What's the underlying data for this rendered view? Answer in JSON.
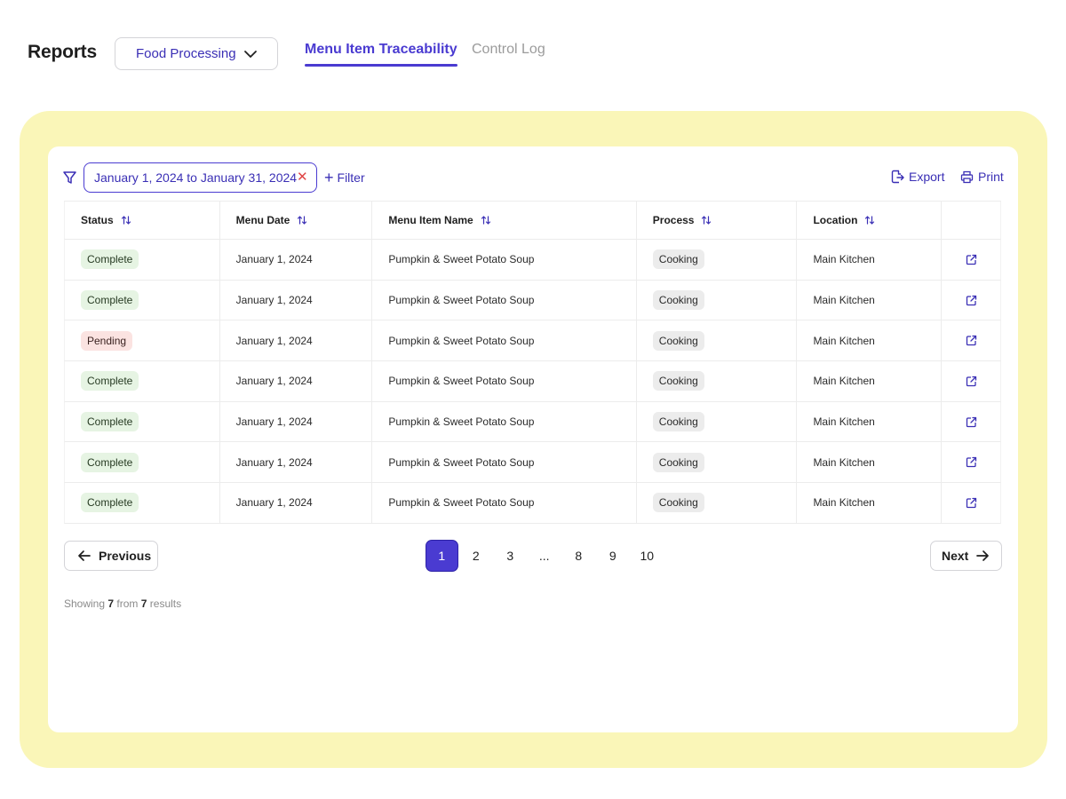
{
  "header": {
    "title": "Reports",
    "department_select": {
      "value": "Food Processing"
    },
    "tabs": [
      {
        "label": "Menu Item Traceability",
        "active": true
      },
      {
        "label": "Control Log",
        "active": false
      }
    ]
  },
  "colors": {
    "accent": "#4a3bd1",
    "frame": "#faf6b8",
    "complete_bg": "#e6f4e3",
    "pending_bg": "#fbe3e1"
  },
  "toolbar": {
    "date_range": "January 1, 2024 to January 31, 2024",
    "filter_label": "Filter",
    "export_label": "Export",
    "print_label": "Print"
  },
  "table": {
    "columns": [
      "Status",
      "Menu Date",
      "Menu Item Name",
      "Process",
      "Location"
    ],
    "rows": [
      {
        "status": "Complete",
        "menu_date": "January 1, 2024",
        "item": "Pumpkin & Sweet Potato Soup",
        "process": "Cooking",
        "location": "Main Kitchen"
      },
      {
        "status": "Complete",
        "menu_date": "January 1, 2024",
        "item": "Pumpkin & Sweet Potato Soup",
        "process": "Cooking",
        "location": "Main Kitchen"
      },
      {
        "status": "Pending",
        "menu_date": "January 1, 2024",
        "item": "Pumpkin & Sweet Potato Soup",
        "process": "Cooking",
        "location": "Main Kitchen"
      },
      {
        "status": "Complete",
        "menu_date": "January 1, 2024",
        "item": "Pumpkin & Sweet Potato Soup",
        "process": "Cooking",
        "location": "Main Kitchen"
      },
      {
        "status": "Complete",
        "menu_date": "January 1, 2024",
        "item": "Pumpkin & Sweet Potato Soup",
        "process": "Cooking",
        "location": "Main Kitchen"
      },
      {
        "status": "Complete",
        "menu_date": "January 1, 2024",
        "item": "Pumpkin & Sweet Potato Soup",
        "process": "Cooking",
        "location": "Main Kitchen"
      },
      {
        "status": "Complete",
        "menu_date": "January 1, 2024",
        "item": "Pumpkin & Sweet Potato Soup",
        "process": "Cooking",
        "location": "Main Kitchen"
      }
    ]
  },
  "pagination": {
    "previous_label": "Previous",
    "next_label": "Next",
    "pages": [
      "1",
      "2",
      "3",
      "...",
      "8",
      "9",
      "10"
    ],
    "current": "1"
  },
  "summary": {
    "prefix": "Showing",
    "shown": "7",
    "middle": "from",
    "total": "7",
    "suffix": "results"
  }
}
